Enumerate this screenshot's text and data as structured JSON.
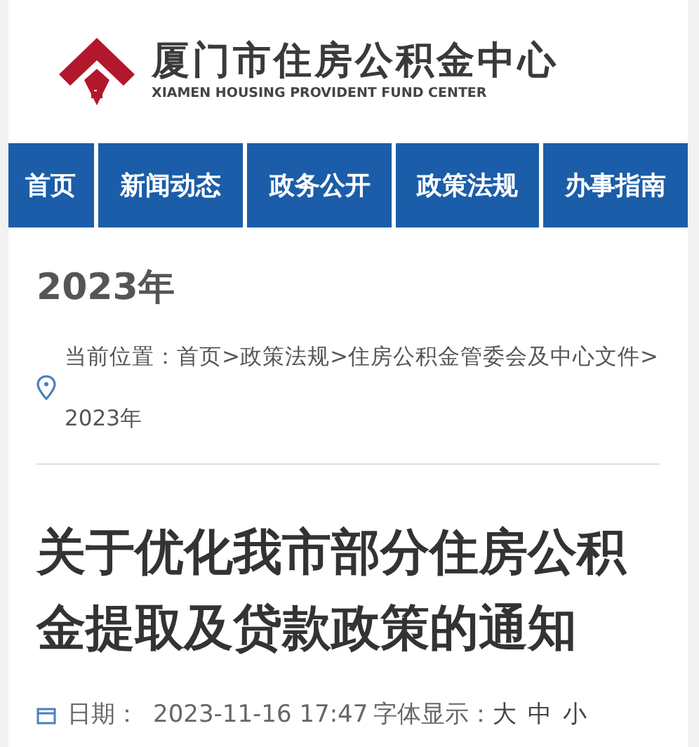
{
  "header": {
    "title": "厦门市住房公积金中心",
    "subtitle": "XIAMEN HOUSING PROVIDENT FUND CENTER"
  },
  "nav": [
    {
      "label": "首页"
    },
    {
      "label": "新闻动态"
    },
    {
      "label": "政务公开"
    },
    {
      "label": "政策法规"
    },
    {
      "label": "办事指南"
    }
  ],
  "section_title": "2023年",
  "breadcrumb": "当前位置：首页>政策法规>住房公积金管委会及中心文件>2023年",
  "article": {
    "title": "关于优化我市部分住房公积金提取及贷款政策的通知",
    "date_label": "日期：",
    "date": "2023-11-16 17:47",
    "font_label": "字体显示：",
    "font_sizes": [
      "大",
      "中",
      "小"
    ]
  }
}
